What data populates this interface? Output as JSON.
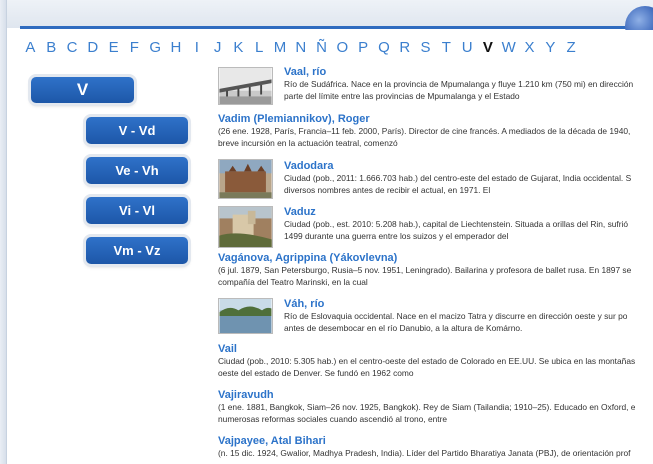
{
  "alphabet": {
    "letters": [
      "A",
      "B",
      "C",
      "D",
      "E",
      "F",
      "G",
      "H",
      "I",
      "J",
      "K",
      "L",
      "M",
      "N",
      "Ñ",
      "O",
      "P",
      "Q",
      "R",
      "S",
      "T",
      "U",
      "V",
      "W",
      "X",
      "Y",
      "Z"
    ],
    "active": "V"
  },
  "sidebar": {
    "main_label": "V",
    "ranges": [
      "V - Vd",
      "Ve - Vh",
      "Vi - Vl",
      "Vm - Vz"
    ]
  },
  "entries": [
    {
      "title": "Vaal, río",
      "lines": [
        "Río de Sudáfrica. Nace en la provincia de Mpumalanga y fluye 1.210 km (750 mi) en dirección",
        "parte del límite entre las provincias de Mpumalanga y el Estado"
      ],
      "thumb": "river-bridge-photo"
    },
    {
      "title": "Vadim (Plemiannikov), Roger",
      "lines": [
        "(26 ene. 1928, París, Francia–11 feb. 2000, París). Director de cine francés. A mediados de la década de 1940,",
        "breve incursión en la actuación teatral, comenzó"
      ]
    },
    {
      "title": "Vadodara",
      "lines": [
        "Ciudad (pob., 2011: 1.666.703 hab.) del centro-este del estado de Gujarat, India occidental. S",
        "diversos nombres antes de recibir el actual, en 1971. El"
      ],
      "thumb": "palace-photo"
    },
    {
      "title": "Vaduz",
      "lines": [
        "Ciudad (pob., est. 2010: 5.208 hab.), capital de Liechtenstein. Situada a orillas del Rin, sufrió",
        "1499 durante una guerra entre los suizos y el emperador del"
      ],
      "thumb": "castle-photo"
    },
    {
      "title": "Vagánova, Agrippina (Yákovlevna)",
      "lines": [
        "(6 jul. 1879, San Petersburgo, Rusia–5 nov. 1951, Leningrado). Bailarina y profesora de ballet rusa. En 1897 se",
        "compañía del Teatro Marinski, en la cual"
      ]
    },
    {
      "title": "Váh, río",
      "lines": [
        "Río de Eslovaquia occidental. Nace en el macizo Tatra y discurre en dirección oeste y sur po",
        "antes de desembocar en el río Danubio, a la altura de Komárno."
      ],
      "thumb": "lake-photo"
    },
    {
      "title": "Vail",
      "lines": [
        "Ciudad (pob., 2010: 5.305 hab.) en el centro-oeste del estado de Colorado en EE.UU. Se ubica en las montañas",
        "oeste del estado de Denver. Se fundó en 1962 como"
      ]
    },
    {
      "title": "Vajiravudh",
      "lines": [
        "(1 ene. 1881, Bangkok, Siam–26 nov. 1925, Bangkok). Rey de Siam (Tailandia; 1910–25). Educado en Oxford, e",
        "numerosas reformas sociales cuando ascendió al trono, entre"
      ]
    },
    {
      "title": "Vajpayee, Atal Bihari",
      "lines": [
        "(n. 15 dic. 1924, Gwalior, Madhya Pradesh, India). Líder del Partido Bharatiya Janata (PBJ), de orientación prof"
      ]
    }
  ]
}
